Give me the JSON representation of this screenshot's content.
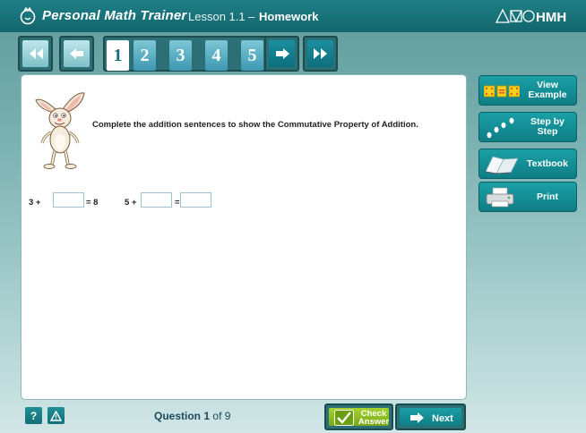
{
  "header": {
    "brand": "Personal Math Trainer",
    "lesson_prefix": "Lesson 1.1 –",
    "lesson_suffix": "Homework",
    "logo_text": "HMH",
    "brand_icon": "pmt-logo-icon"
  },
  "nav": {
    "first_icon": "double-chevron-left-icon",
    "prev_icon": "arrow-left-icon",
    "next_icon": "arrow-right-icon",
    "last_icon": "double-chevron-right-icon",
    "questions": [
      "1",
      "2",
      "3",
      "4",
      "5"
    ],
    "active_question": "1"
  },
  "question": {
    "instruction": "Complete the addition sentences to show the Commutative Property of Addition.",
    "eq1_prefix": "3 +",
    "eq1_suffix": "= 8",
    "eq2_prefix": "5 +",
    "eq2_eq": "=",
    "eq1_value": "",
    "eq2_value1": "",
    "eq2_value2": ""
  },
  "tools": [
    {
      "label": "View Example",
      "icon": "dice-example-icon"
    },
    {
      "label": "Step by Step",
      "icon": "footsteps-icon"
    },
    {
      "label": "Textbook",
      "icon": "open-book-icon"
    },
    {
      "label": "Print",
      "icon": "printer-icon"
    }
  ],
  "footer": {
    "help_label": "?",
    "alert_icon": "warning-icon",
    "question_word": "Question",
    "current": "1",
    "of_text": "of 9",
    "check_line1": "Check",
    "check_line2": "Answer",
    "next_label": "Next"
  },
  "colors": {
    "header": "#1e7f86",
    "accent_teal": "#0f7d85",
    "check_green": "#8bc220",
    "active_number": "#1a6c84"
  }
}
